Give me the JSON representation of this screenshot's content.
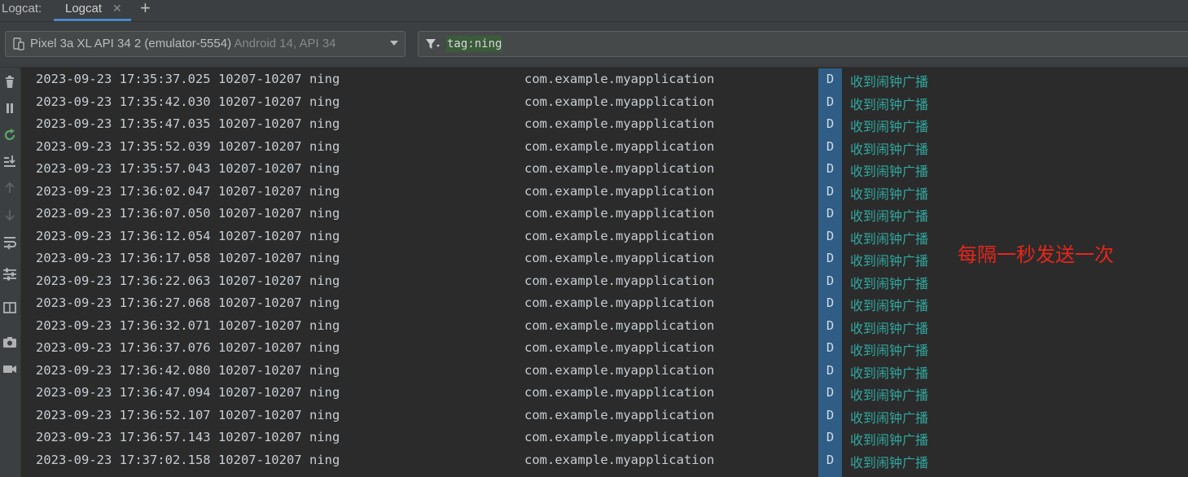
{
  "tabs": {
    "prefix": "Logcat:",
    "active_label": "Logcat",
    "close_glyph": "✕",
    "add_glyph": "+"
  },
  "toolbar": {
    "device_name": "Pixel 3a XL API 34 2 (emulator-5554)",
    "device_os": "Android 14, API 34",
    "device_icon": "device-phone-icon",
    "filter_icon": "filter-icon",
    "filter_query": "tag:ning"
  },
  "sidebar": {
    "icons": [
      "trash-icon",
      "pause-icon",
      "restart-icon",
      "scroll-to-end-icon",
      "up-arrow-icon",
      "down-arrow-icon",
      "soft-wrap-icon",
      "settings-sliders-icon",
      "split-panel-icon",
      "camera-icon",
      "video-icon"
    ]
  },
  "log": {
    "rows": [
      {
        "time": "2023-09-23 17:35:37.025 10207-10207 ning",
        "pkg": "com.example.myapplication",
        "level": "D",
        "msg": "收到闹钟广播"
      },
      {
        "time": "2023-09-23 17:35:42.030 10207-10207 ning",
        "pkg": "com.example.myapplication",
        "level": "D",
        "msg": "收到闹钟广播"
      },
      {
        "time": "2023-09-23 17:35:47.035 10207-10207 ning",
        "pkg": "com.example.myapplication",
        "level": "D",
        "msg": "收到闹钟广播"
      },
      {
        "time": "2023-09-23 17:35:52.039 10207-10207 ning",
        "pkg": "com.example.myapplication",
        "level": "D",
        "msg": "收到闹钟广播"
      },
      {
        "time": "2023-09-23 17:35:57.043 10207-10207 ning",
        "pkg": "com.example.myapplication",
        "level": "D",
        "msg": "收到闹钟广播"
      },
      {
        "time": "2023-09-23 17:36:02.047 10207-10207 ning",
        "pkg": "com.example.myapplication",
        "level": "D",
        "msg": "收到闹钟广播"
      },
      {
        "time": "2023-09-23 17:36:07.050 10207-10207 ning",
        "pkg": "com.example.myapplication",
        "level": "D",
        "msg": "收到闹钟广播"
      },
      {
        "time": "2023-09-23 17:36:12.054 10207-10207 ning",
        "pkg": "com.example.myapplication",
        "level": "D",
        "msg": "收到闹钟广播"
      },
      {
        "time": "2023-09-23 17:36:17.058 10207-10207 ning",
        "pkg": "com.example.myapplication",
        "level": "D",
        "msg": "收到闹钟广播"
      },
      {
        "time": "2023-09-23 17:36:22.063 10207-10207 ning",
        "pkg": "com.example.myapplication",
        "level": "D",
        "msg": "收到闹钟广播"
      },
      {
        "time": "2023-09-23 17:36:27.068 10207-10207 ning",
        "pkg": "com.example.myapplication",
        "level": "D",
        "msg": "收到闹钟广播"
      },
      {
        "time": "2023-09-23 17:36:32.071 10207-10207 ning",
        "pkg": "com.example.myapplication",
        "level": "D",
        "msg": "收到闹钟广播"
      },
      {
        "time": "2023-09-23 17:36:37.076 10207-10207 ning",
        "pkg": "com.example.myapplication",
        "level": "D",
        "msg": "收到闹钟广播"
      },
      {
        "time": "2023-09-23 17:36:42.080 10207-10207 ning",
        "pkg": "com.example.myapplication",
        "level": "D",
        "msg": "收到闹钟广播"
      },
      {
        "time": "2023-09-23 17:36:47.094 10207-10207 ning",
        "pkg": "com.example.myapplication",
        "level": "D",
        "msg": "收到闹钟广播"
      },
      {
        "time": "2023-09-23 17:36:52.107 10207-10207 ning",
        "pkg": "com.example.myapplication",
        "level": "D",
        "msg": "收到闹钟广播"
      },
      {
        "time": "2023-09-23 17:36:57.143 10207-10207 ning",
        "pkg": "com.example.myapplication",
        "level": "D",
        "msg": "收到闹钟广播"
      },
      {
        "time": "2023-09-23 17:37:02.158 10207-10207 ning",
        "pkg": "com.example.myapplication",
        "level": "D",
        "msg": "收到闹钟广播"
      }
    ]
  },
  "annotation": "每隔一秒发送一次",
  "colors": {
    "background": "#2b2b2b",
    "panel": "#3c3f41",
    "level_debug_bg": "#2f5d85",
    "message_text": "#31a8a0",
    "annotation_red": "#e8261b",
    "tab_underline": "#4a88c7"
  }
}
